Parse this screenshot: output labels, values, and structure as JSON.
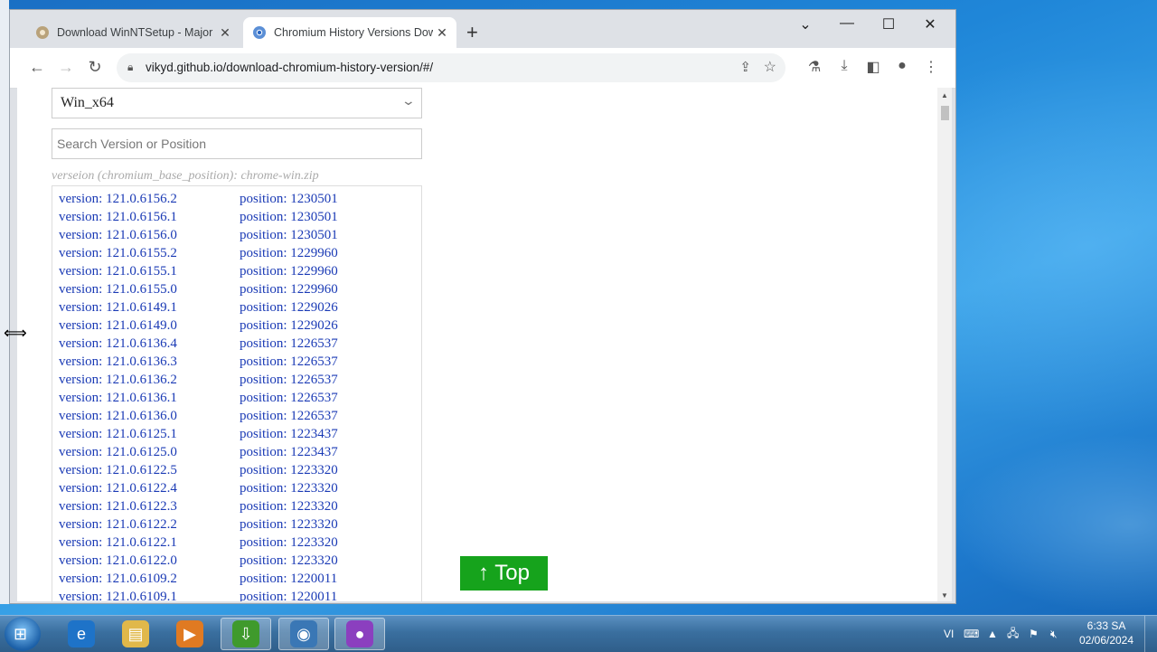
{
  "browser": {
    "tabs": [
      {
        "title": "Download WinNTSetup - Major",
        "icon": "tab-favicon-icon"
      },
      {
        "title": "Chromium History Versions Dow",
        "icon": "chromium-favicon-icon"
      }
    ],
    "new_tab": "+",
    "window_controls": {
      "list": "⌄",
      "minimize": "—",
      "maximize": "☐",
      "close": "✕"
    },
    "url": "vikyd.github.io/download-chromium-history-version/#/"
  },
  "page": {
    "platform": "Win_x64",
    "search_placeholder": "Search Version or Position",
    "hint": "verseion (chromium_base_position): chrome-win.zip",
    "rows": [
      {
        "version": "version: 121.0.6156.2",
        "position": "position: 1230501"
      },
      {
        "version": "version: 121.0.6156.1",
        "position": "position: 1230501"
      },
      {
        "version": "version: 121.0.6156.0",
        "position": "position: 1230501"
      },
      {
        "version": "version: 121.0.6155.2",
        "position": "position: 1229960"
      },
      {
        "version": "version: 121.0.6155.1",
        "position": "position: 1229960"
      },
      {
        "version": "version: 121.0.6155.0",
        "position": "position: 1229960"
      },
      {
        "version": "version: 121.0.6149.1",
        "position": "position: 1229026"
      },
      {
        "version": "version: 121.0.6149.0",
        "position": "position: 1229026"
      },
      {
        "version": "version: 121.0.6136.4",
        "position": "position: 1226537"
      },
      {
        "version": "version: 121.0.6136.3",
        "position": "position: 1226537"
      },
      {
        "version": "version: 121.0.6136.2",
        "position": "position: 1226537"
      },
      {
        "version": "version: 121.0.6136.1",
        "position": "position: 1226537"
      },
      {
        "version": "version: 121.0.6136.0",
        "position": "position: 1226537"
      },
      {
        "version": "version: 121.0.6125.1",
        "position": "position: 1223437"
      },
      {
        "version": "version: 121.0.6125.0",
        "position": "position: 1223437"
      },
      {
        "version": "version: 121.0.6122.5",
        "position": "position: 1223320"
      },
      {
        "version": "version: 121.0.6122.4",
        "position": "position: 1223320"
      },
      {
        "version": "version: 121.0.6122.3",
        "position": "position: 1223320"
      },
      {
        "version": "version: 121.0.6122.2",
        "position": "position: 1223320"
      },
      {
        "version": "version: 121.0.6122.1",
        "position": "position: 1223320"
      },
      {
        "version": "version: 121.0.6122.0",
        "position": "position: 1223320"
      },
      {
        "version": "version: 121.0.6109.2",
        "position": "position: 1220011"
      },
      {
        "version": "version: 121.0.6109.1",
        "position": "position: 1220011"
      }
    ],
    "top_button": "↑ Top"
  },
  "taskbar": {
    "apps": [
      {
        "name": "internet-explorer",
        "icon": "ie-icon",
        "glyph": "e",
        "color": "#1e73c8",
        "active": false
      },
      {
        "name": "file-explorer",
        "icon": "folder-icon",
        "glyph": "▤",
        "color": "#e0b84a",
        "active": false
      },
      {
        "name": "media-player",
        "icon": "media-player-icon",
        "glyph": "▶",
        "color": "#e07a22",
        "active": false
      },
      {
        "name": "download-manager",
        "icon": "download-manager-icon",
        "glyph": "⇩",
        "color": "#3f9a2c",
        "active": true
      },
      {
        "name": "chromium",
        "icon": "chromium-icon",
        "glyph": "◉",
        "color": "#3a77b5",
        "active": true
      },
      {
        "name": "app-ball",
        "icon": "app-ball-icon",
        "glyph": "●",
        "color": "#8b3fbf",
        "active": true
      }
    ],
    "language": "VI",
    "time": "6:33 SA",
    "date": "02/06/2024"
  }
}
